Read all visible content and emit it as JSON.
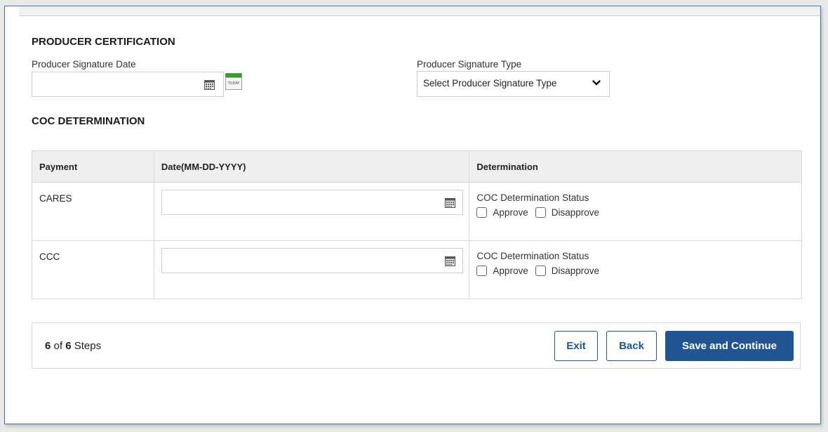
{
  "producer_certification": {
    "section_title": "PRODUCER CERTIFICATION",
    "signature_date_label": "Producer Signature Date",
    "signature_date_value": "",
    "today_icon_text": "TODAY",
    "signature_type_label": "Producer Signature Type",
    "signature_type_selected": "Select Producer Signature Type"
  },
  "coc_determination": {
    "section_title": "COC DETERMINATION",
    "columns": [
      "Payment",
      "Date(MM-DD-YYYY)",
      "Determination"
    ],
    "rows": [
      {
        "payment": "CARES",
        "date": "",
        "status_label": "COC Determination Status",
        "approve_label": "Approve",
        "disapprove_label": "Disapprove"
      },
      {
        "payment": "CCC",
        "date": "",
        "status_label": "COC Determination Status",
        "approve_label": "Approve",
        "disapprove_label": "Disapprove"
      }
    ]
  },
  "footer": {
    "current_step": "6",
    "of_text": "of",
    "total_steps": "6",
    "steps_text": "Steps",
    "exit_label": "Exit",
    "back_label": "Back",
    "save_label": "Save and Continue"
  },
  "colors": {
    "primary": "#205493",
    "frame_border": "#4a6fb0",
    "header_bg": "#efefef",
    "today_green": "#3a9a2e"
  },
  "icons": {
    "calendar": "calendar-icon",
    "today": "today-calendar-icon",
    "select_arrow": "chevron-down-icon"
  }
}
